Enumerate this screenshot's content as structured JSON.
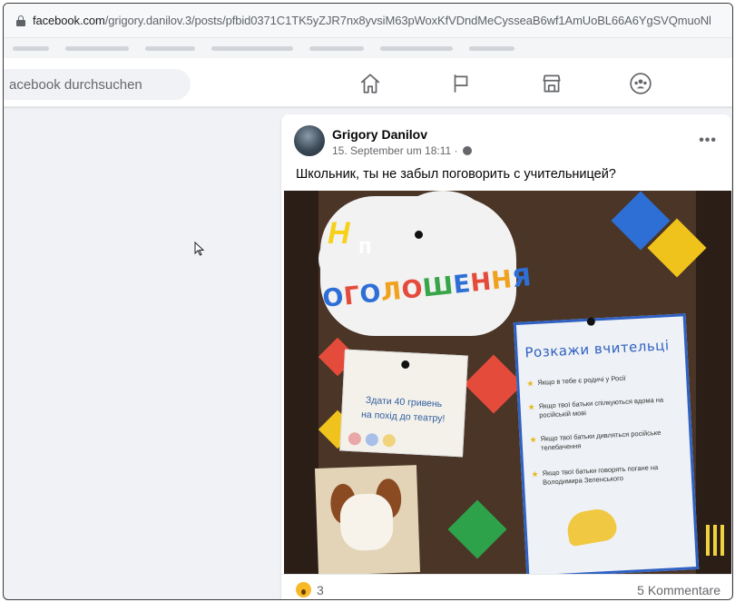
{
  "browser": {
    "url_host": "facebook.com",
    "url_path": "/grigory.danilov.3/posts/pfbid0371C1TK5yZJR7nx8yvsiM63pWoxKfVDndMeCysseaB6wf1AmUoBL66A6YgSVQmuoNl"
  },
  "header": {
    "search_placeholder": "acebook durchsuchen",
    "nav": [
      {
        "icon": "home-icon"
      },
      {
        "icon": "pages-flag-icon"
      },
      {
        "icon": "marketplace-icon"
      },
      {
        "icon": "groups-icon"
      }
    ]
  },
  "post": {
    "author": "Grigory Danilov",
    "timestamp": "15. September um 18:11 ·",
    "caption": "Школьник, ты не забыл поговорить с учительницей?",
    "more_label": "•••",
    "image": {
      "headline": "ОГОЛОШЕННЯ",
      "headline_colors": [
        "#2e6fd6",
        "#e44b3a",
        "#2e6fd6",
        "#f0a11e",
        "#e44b3a",
        "#37a548",
        "#2e6fd6",
        "#e44b3a",
        "#f0a11e",
        "#2e6fd6"
      ],
      "note_text": "Здати 40 гривень\nна похід до театру!",
      "poster_title": "Розкажи вчительці",
      "poster_items": [
        "Якщо в тебе є родичі у Росії",
        "Якщо твої батьки спілкуються вдома на російській мові",
        "Якщо твої батьки дивляться російське телебачення",
        "Якщо твої батьки говорять погане на Володимира Зеленського"
      ],
      "logo_h": "Н",
      "logo_p": "п"
    },
    "reactions": {
      "icon": "wow-reaction-icon",
      "count": "3"
    },
    "comments": "5 Kommentare"
  },
  "colors": {
    "fb_bg": "#f0f2f5",
    "accent_blue": "#2f61c2",
    "text_secondary": "#65676b"
  }
}
